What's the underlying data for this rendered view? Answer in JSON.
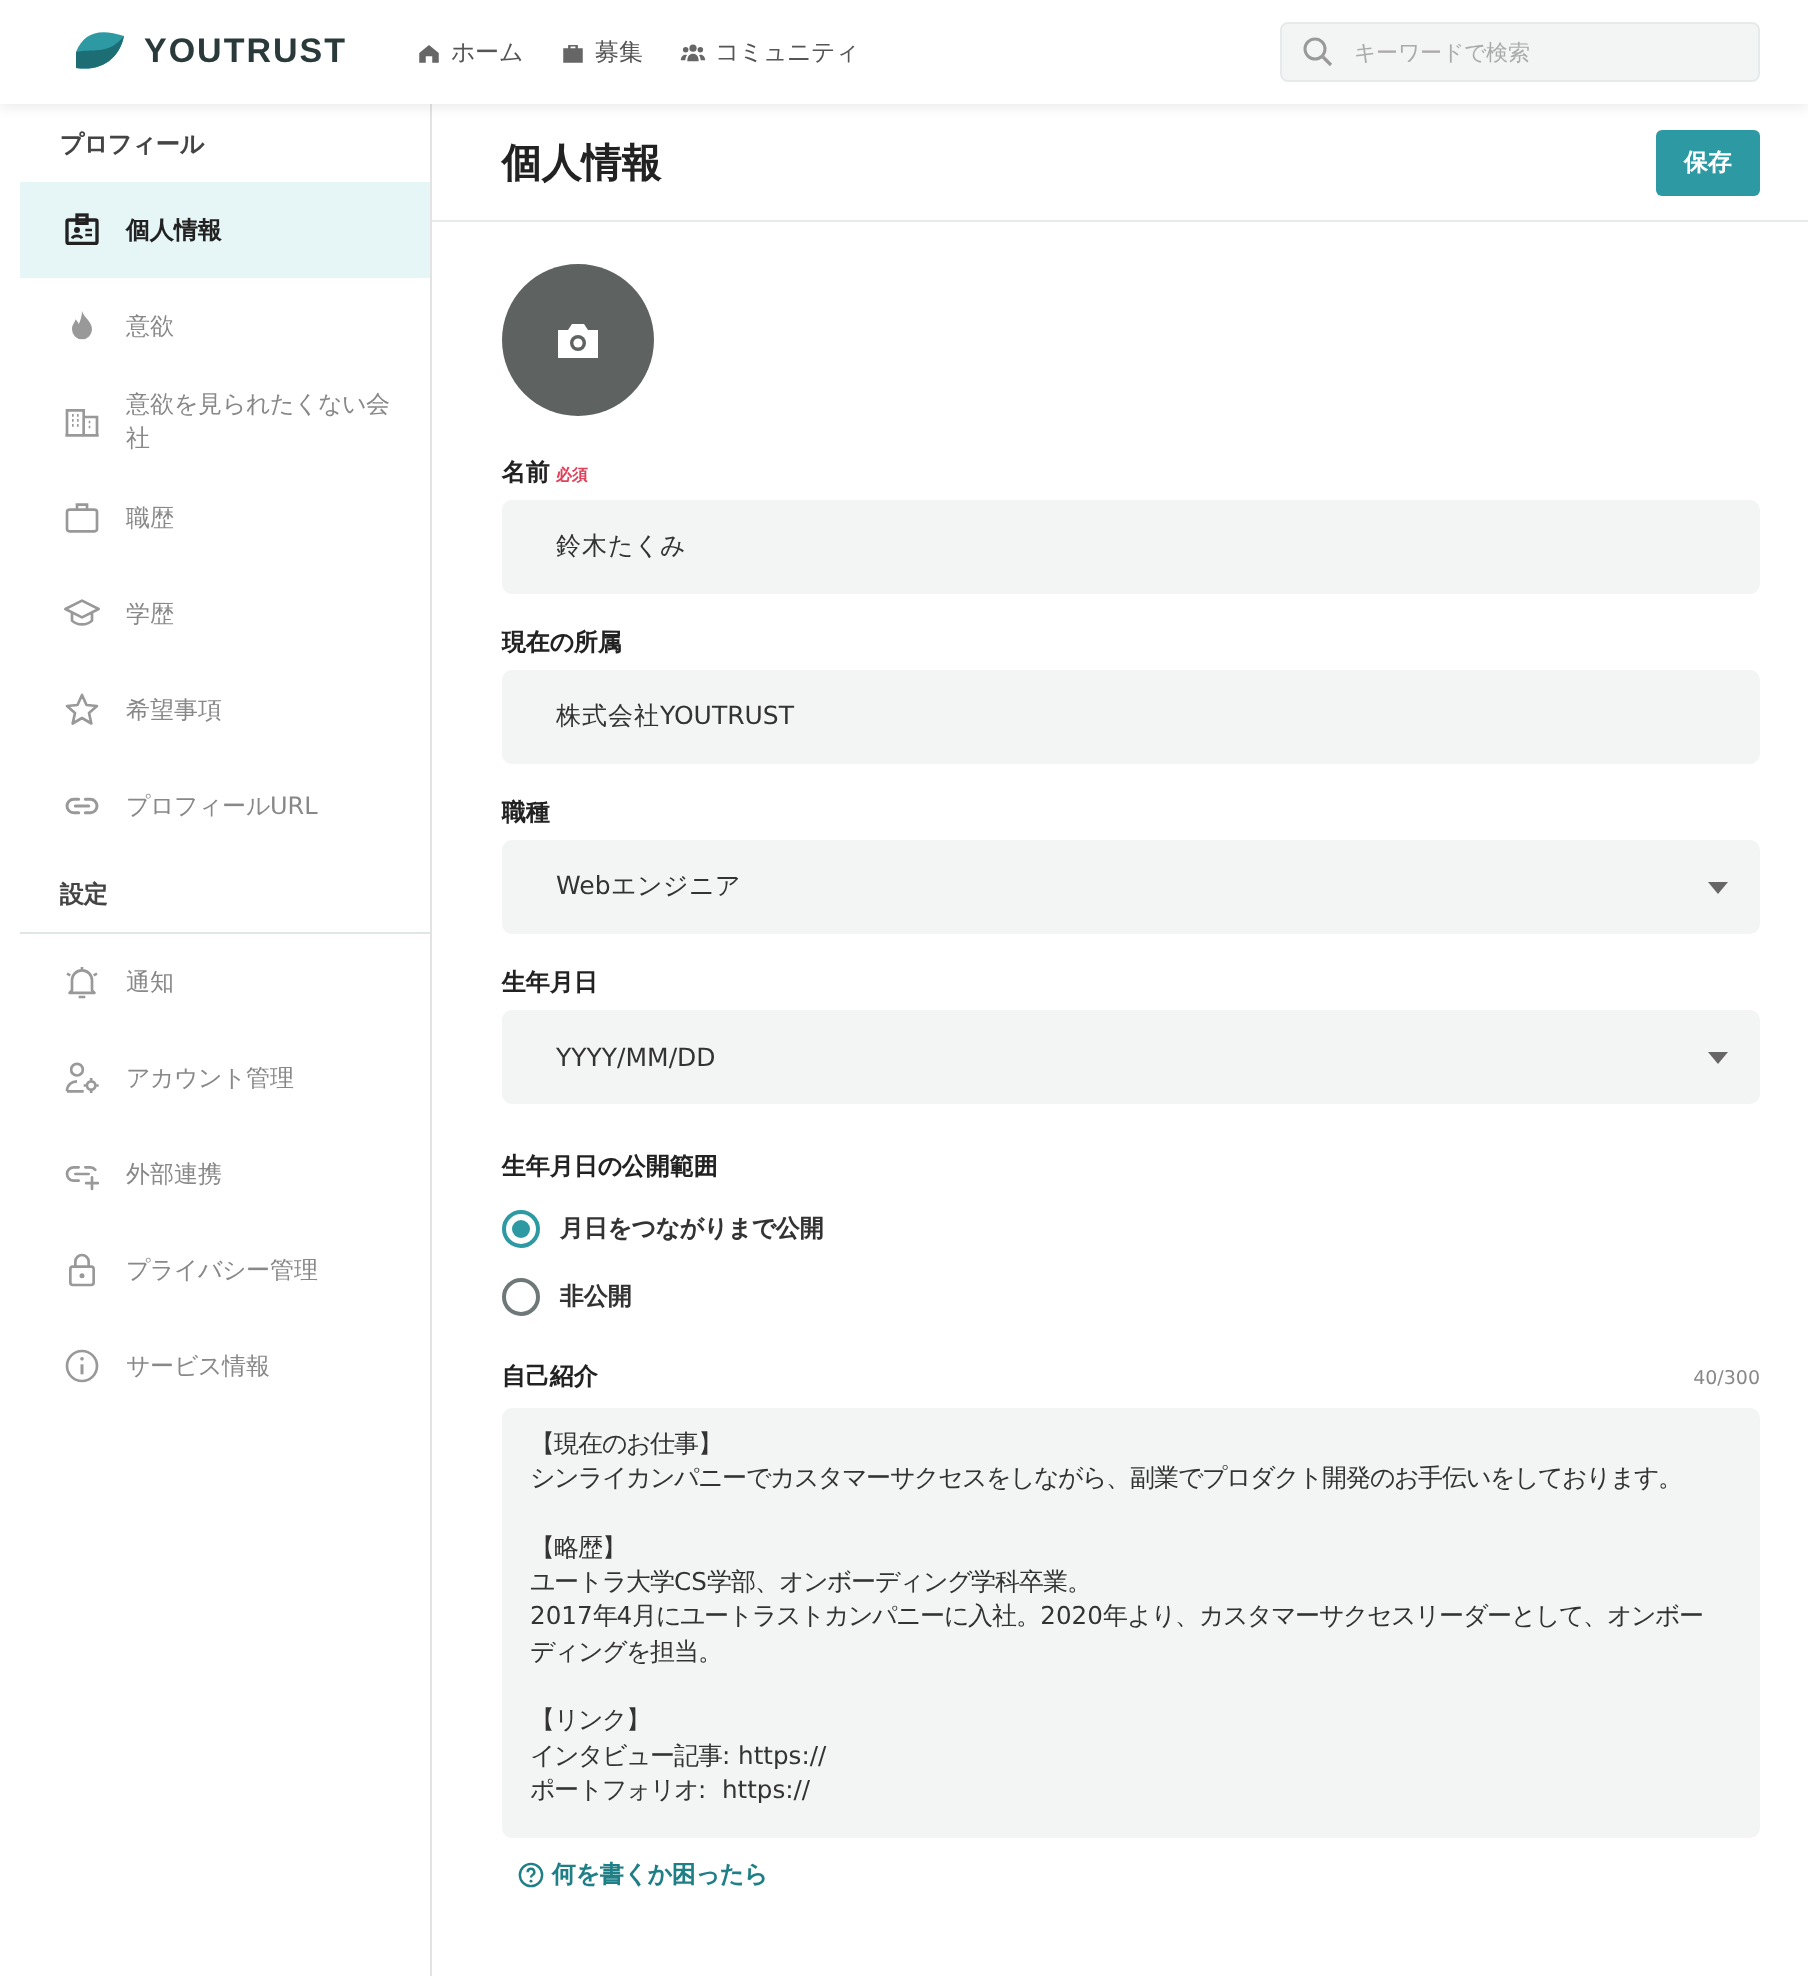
{
  "header": {
    "logo": "YOUTRUST",
    "nav": [
      {
        "label": "ホーム"
      },
      {
        "label": "募集"
      },
      {
        "label": "コミュニティ"
      }
    ],
    "search": {
      "placeholder": "キーワードで検索"
    }
  },
  "sidebar": {
    "sections": [
      {
        "heading": "プロフィール",
        "items": [
          {
            "label": "個人情報",
            "selected": true
          },
          {
            "label": "意欲",
            "selected": false
          },
          {
            "label": "意欲を見られたくない会社",
            "selected": false
          },
          {
            "label": "職歴",
            "selected": false
          },
          {
            "label": "学歴",
            "selected": false
          },
          {
            "label": "希望事項",
            "selected": false
          },
          {
            "label": "プロフィールURL",
            "selected": false
          }
        ]
      },
      {
        "heading": "設定",
        "items": [
          {
            "label": "通知",
            "selected": false
          },
          {
            "label": "アカウント管理",
            "selected": false
          },
          {
            "label": "外部連携",
            "selected": false
          },
          {
            "label": "プライバシー管理",
            "selected": false
          },
          {
            "label": "サービス情報",
            "selected": false
          }
        ]
      }
    ]
  },
  "page": {
    "title": "個人情報",
    "save_button": "保存"
  },
  "form": {
    "fields": [
      {
        "kind": "text",
        "label": "名前",
        "required_badge": "必須",
        "value": "鈴木たくみ"
      },
      {
        "kind": "text",
        "label": "現在の所属",
        "value": "株式会社YOUTRUST"
      },
      {
        "kind": "select",
        "label": "職種",
        "value": "Webエンジニア"
      },
      {
        "kind": "select",
        "label": "生年月日",
        "value": "YYYY/MM/DD"
      }
    ],
    "visibility": {
      "label": "生年月日の公開範囲",
      "options": [
        {
          "label": "月日をつながりまで公開",
          "selected": true
        },
        {
          "label": "非公開",
          "selected": false
        }
      ]
    },
    "bio": {
      "label": "自己紹介",
      "counter": "40/300",
      "paragraphs": [
        [
          "【現在のお仕事】",
          "シンライカンパニーでカスタマーサクセスをしながら、副業でプロダクト開発のお手伝いをしております。"
        ],
        [
          "【略歴】",
          "ユートラ大学CS学部、オンボーディング学科卒業。",
          "2017年4月にユートラストカンパニーに入社。2020年より、カスタマーサクセスリーダーとして、オンボー",
          "ディングを担当。"
        ],
        [
          "【リンク】",
          "インタビュー記事: https://",
          "ポートフォリオ:  https://"
        ]
      ]
    },
    "help_link": "何を書くか困ったら"
  }
}
